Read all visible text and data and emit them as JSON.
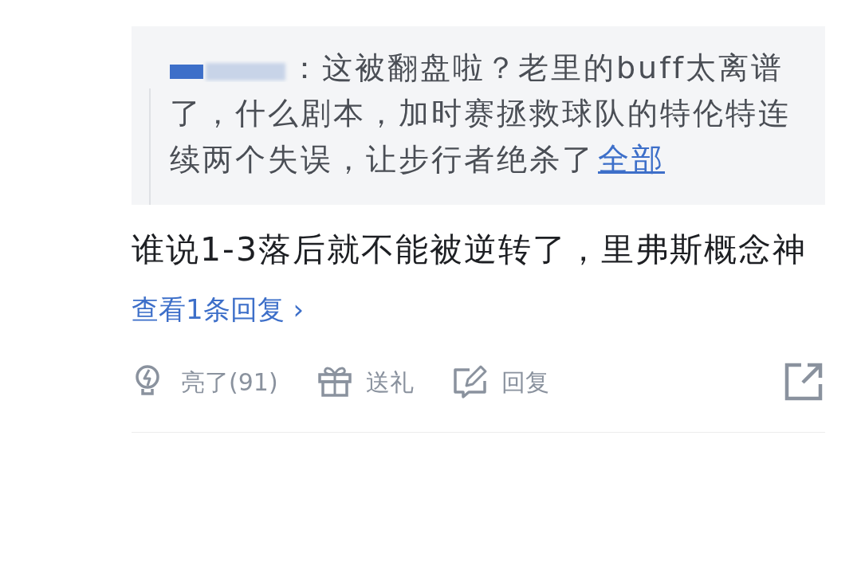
{
  "quote": {
    "separator": "：",
    "text": "这被翻盘啦？老里的buff太离谱了，什么剧本，加时赛拯救球队的特伦特连续两个失误，让步行者绝杀了",
    "more_label": "全部"
  },
  "comment": {
    "text": "谁说1-3落后就不能被逆转了，里弗斯概念神"
  },
  "replies_link": {
    "label": "查看1条回复",
    "arrow": "›"
  },
  "actions": [
    {
      "kind": "like",
      "label": "亮了(91)"
    },
    {
      "kind": "gift",
      "label": "送礼"
    },
    {
      "kind": "reply",
      "label": "回复"
    }
  ]
}
